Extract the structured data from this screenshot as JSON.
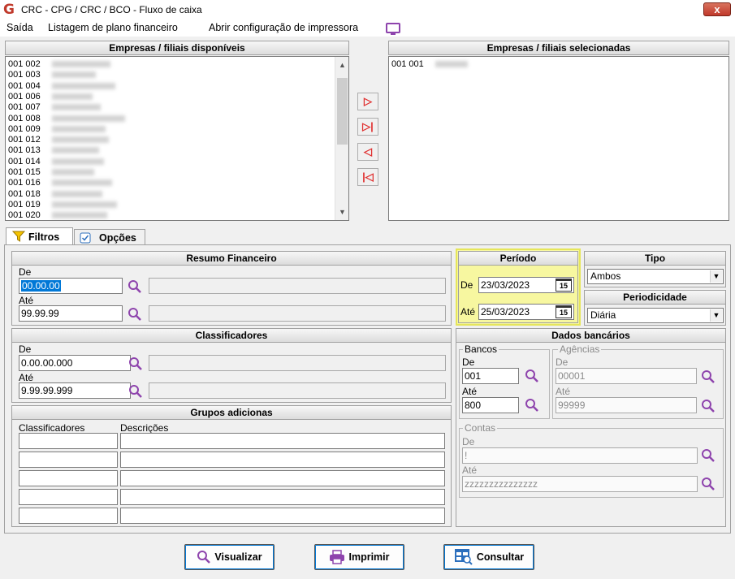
{
  "window": {
    "title": "CRC - CPG / CRC / BCO - Fluxo de caixa",
    "close": "x"
  },
  "menu": {
    "saida": "Saída",
    "listagem": "Listagem de plano financeiro",
    "abrir": "Abrir configuração de impressora"
  },
  "available": {
    "header": "Empresas / filiais disponíveis",
    "items": [
      "001 002",
      "001 003",
      "001 004",
      "001 006",
      "001 007",
      "001 008",
      "001 009",
      "001 012",
      "001 013",
      "001 014",
      "001 015",
      "001 016",
      "001 018",
      "001 019",
      "001 020"
    ]
  },
  "selected": {
    "header": "Empresas / filiais selecionadas",
    "items": [
      "001 001"
    ]
  },
  "tabs": {
    "filtros": "Filtros",
    "opcoes": "Opções"
  },
  "resumo": {
    "header": "Resumo Financeiro",
    "de_label": "De",
    "de_value": "00.00.00",
    "ate_label": "Até",
    "ate_value": "99.99.99"
  },
  "classificadores": {
    "header": "Classificadores",
    "de_label": "De",
    "de_value": "0.00.00.000",
    "ate_label": "Até",
    "ate_value": "9.99.99.999"
  },
  "grupos": {
    "header": "Grupos adicionas",
    "col1": "Classificadores",
    "col2": "Descrições"
  },
  "periodo": {
    "header": "Período",
    "de_label": "De",
    "de_value": "23/03/2023",
    "ate_label": "Até",
    "ate_value": "25/03/2023",
    "cal": "15"
  },
  "tipo": {
    "header": "Tipo",
    "value": "Ambos"
  },
  "periodicidade": {
    "header": "Periodicidade",
    "value": "Diária"
  },
  "dados": {
    "header": "Dados bancários",
    "bancos": {
      "legend": "Bancos",
      "de_label": "De",
      "de_value": "001",
      "ate_label": "Até",
      "ate_value": "800"
    },
    "agencias": {
      "legend": "Agências",
      "de_label": "De",
      "de_value": "00001",
      "ate_label": "Até",
      "ate_value": "99999"
    },
    "contas": {
      "legend": "Contas",
      "de_label": "De",
      "de_value": "!",
      "ate_label": "Até",
      "ate_value": "zzzzzzzzzzzzzzz"
    }
  },
  "buttons": {
    "visualizar": "Visualizar",
    "imprimir": "Imprimir",
    "consultar": "Consultar"
  },
  "colors": {
    "highlight": "#f7f7a0",
    "accent": "#8e44ad",
    "arrow_red": "#e03030"
  }
}
